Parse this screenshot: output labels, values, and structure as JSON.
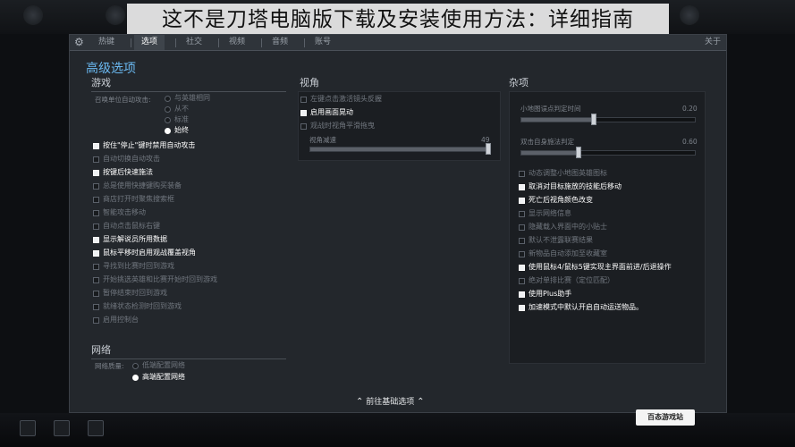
{
  "banner": "这不是刀塔电脑版下载及安装使用方法：详细指南",
  "tabs": [
    "热键",
    "选项",
    "社交",
    "视频",
    "音频",
    "账号"
  ],
  "close_label": "关于",
  "title": "高级选项",
  "game": {
    "header": "游戏",
    "summon_label": "召唤单位自动攻击:",
    "summon_options": [
      "与英雄相同",
      "从不",
      "标准",
      "始终"
    ],
    "summon_selected": 3,
    "items": [
      {
        "label": "按住\"停止\"键时禁用自动攻击",
        "on": true
      },
      {
        "label": "自动切换自动攻击",
        "on": false
      },
      {
        "label": "按键后快速施法",
        "on": true
      },
      {
        "label": "总是使用快捷键购买装备",
        "on": false
      },
      {
        "label": "商店打开时聚焦搜索框",
        "on": false
      },
      {
        "label": "智能攻击移动",
        "on": false
      },
      {
        "label": "自动点击鼠标右键",
        "on": false
      },
      {
        "label": "显示解说员所用数据",
        "on": true
      },
      {
        "label": "鼠标平移时启用观战覆盖视角",
        "on": true
      },
      {
        "label": "寻找到比赛时回到游戏",
        "on": false
      },
      {
        "label": "开始挑选英雄和比赛开始时回到游戏",
        "on": false
      },
      {
        "label": "暂停结束时回到游戏",
        "on": false
      },
      {
        "label": "就绪状态检测时回到游戏",
        "on": false
      },
      {
        "label": "启用控制台",
        "on": false
      }
    ]
  },
  "network": {
    "header": "网络",
    "quality_label": "网络质量:",
    "options": [
      "低端配置网络",
      "高端配置网络"
    ],
    "selected": 1
  },
  "camera": {
    "header": "视角",
    "items": [
      {
        "label": "左键点击激活镜头反握",
        "on": false
      },
      {
        "label": "启用画面晃动",
        "on": true
      },
      {
        "label": "观战时视角平滑拖曳",
        "on": false
      }
    ],
    "slider_label": "视角减速",
    "slider_value": "49",
    "slider_fraction": 1.0
  },
  "misc": {
    "header": "杂项",
    "sliders": [
      {
        "label": "小地图误点判定时间",
        "value": "0.20",
        "fraction": 0.42
      },
      {
        "label": "双击自身施法判定",
        "value": "0.60",
        "fraction": 0.33
      }
    ],
    "items": [
      {
        "label": "动态调整小地图英雄图标",
        "on": false
      },
      {
        "label": "取消对目标施放的技能后移动",
        "on": true
      },
      {
        "label": "死亡后视角颜色改变",
        "on": true
      },
      {
        "label": "显示网络信息",
        "on": false
      },
      {
        "label": "隐藏载入界面中的小贴士",
        "on": false
      },
      {
        "label": "默认不泄露联赛结果",
        "on": false
      },
      {
        "label": "新物品自动添加至收藏室",
        "on": false
      },
      {
        "label": "使用鼠标4/鼠标5键实现主界面前进/后退操作",
        "on": true
      },
      {
        "label": "绝对单排比赛（定位匹配）",
        "on": false
      },
      {
        "label": "使用Plus助手",
        "on": true
      },
      {
        "label": "加速模式中默认开启自动运送物品。",
        "on": true
      }
    ]
  },
  "footer_label": "前往基础选项",
  "logo_text": "百态游戏站"
}
